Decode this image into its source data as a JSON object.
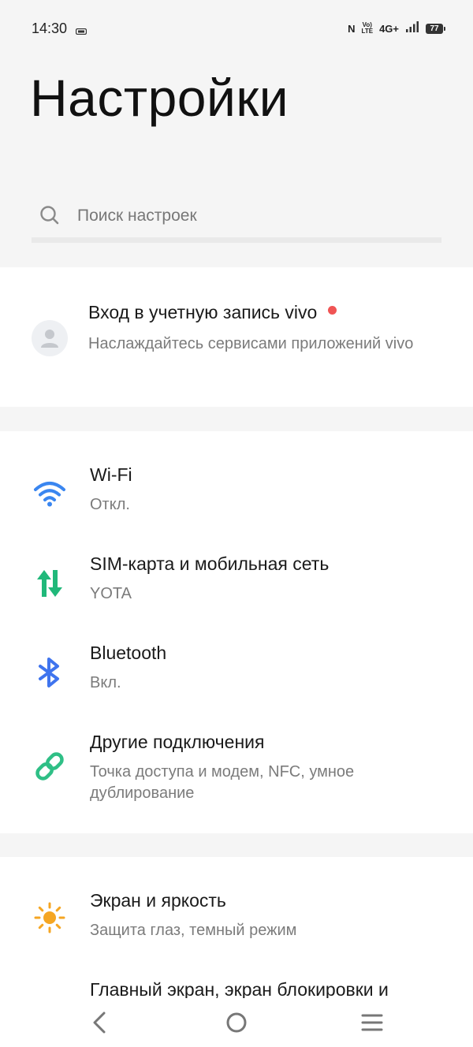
{
  "status_bar": {
    "time": "14:30",
    "nfc": "N",
    "volte_top": "Vo)",
    "volte_bottom": "LTE",
    "network": "4G+",
    "battery": "77"
  },
  "header": {
    "title": "Настройки"
  },
  "search": {
    "placeholder": "Поиск настроек",
    "icon": "search-icon"
  },
  "account": {
    "title": "Вход в учетную запись vivo",
    "subtitle": "Наслаждайтесь сервисами приложений vivo",
    "icon": "person-icon",
    "badge_color": "#f05454"
  },
  "connections": [
    {
      "title": "Wi-Fi",
      "subtitle": "Откл.",
      "icon": "wifi-icon",
      "color": "#3a86f0"
    },
    {
      "title": "SIM-карта и мобильная сеть",
      "subtitle": "YOTA",
      "icon": "mobile-data-icon",
      "color": "#20b87a"
    },
    {
      "title": "Bluetooth",
      "subtitle": "Вкл.",
      "icon": "bluetooth-icon",
      "color": "#3f74ee"
    },
    {
      "title": "Другие подключения",
      "subtitle": "Точка доступа и модем, NFC, умное дублирование",
      "icon": "link-icon",
      "color": "#2fbf86"
    }
  ],
  "display": [
    {
      "title": "Экран и яркость",
      "subtitle": "Защита глаз, темный режим",
      "icon": "sun-icon",
      "color": "#f5a623"
    },
    {
      "title": "Главный экран, экран блокировки и",
      "icon": "home-screen-icon"
    }
  ],
  "nav": {
    "back": "back-icon",
    "home": "home-icon",
    "menu": "menu-icon"
  }
}
